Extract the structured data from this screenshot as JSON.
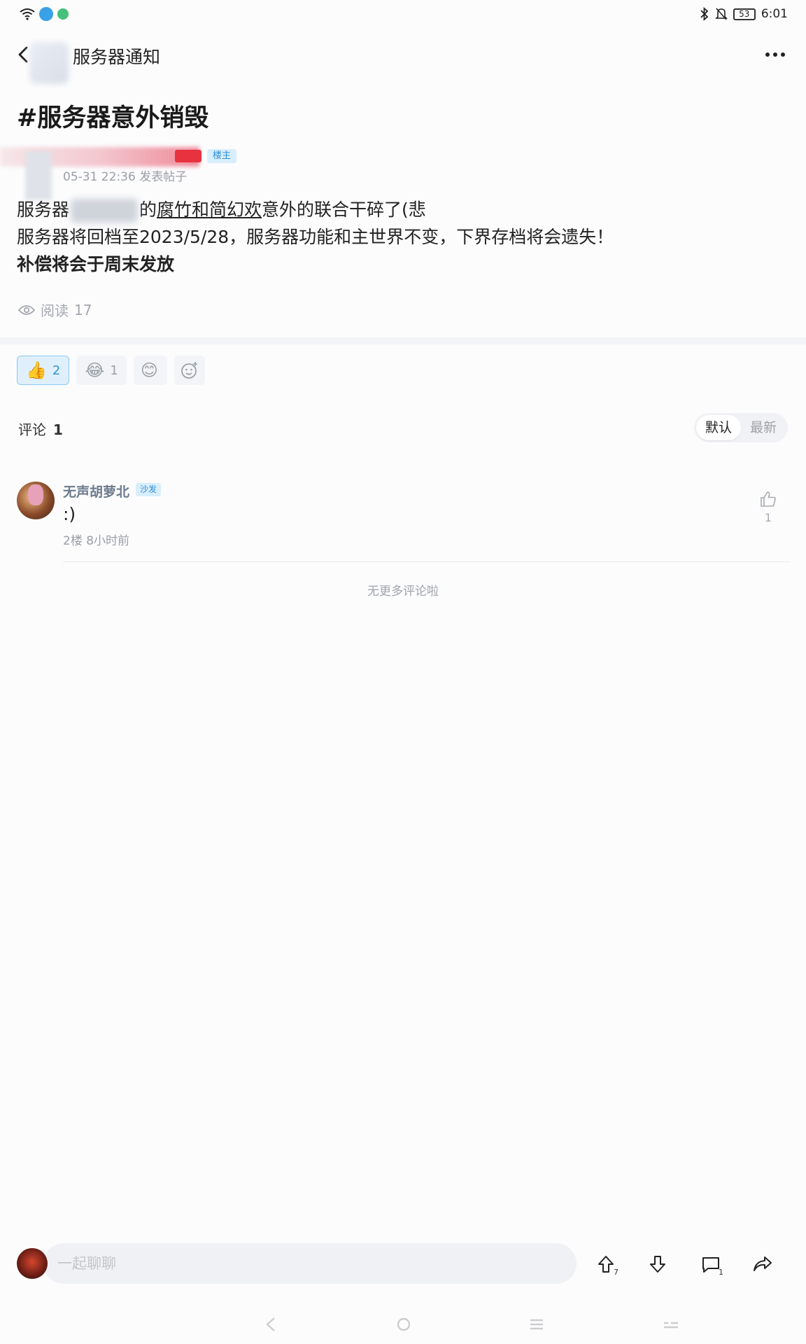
{
  "status_bar": {
    "battery": "53",
    "time": "6:01",
    "icons": [
      "wifi-icon",
      "bluetooth-icon",
      "bell-mute-icon",
      "battery-icon"
    ]
  },
  "header": {
    "title": "服务器通知",
    "back_icon": "chevron-left-icon",
    "more_icon": "more-dots-icon"
  },
  "post": {
    "title": "#服务器意外销毁",
    "author_badge": "楼主",
    "meta": "05-31 22:36 发表帖子",
    "body": {
      "line1_prefix": "服务器",
      "line1_mid": "的",
      "line1_link": "腐竹和简幻欢",
      "line1_suffix": "意外的联合干碎了(悲",
      "line2": "服务器将回档至2023/5/28，服务器功能和主世界不变，下界存档将会遗失！",
      "line3": "补偿将会于周末发放"
    },
    "reads_label": "阅读",
    "reads_count": "17"
  },
  "reactions": [
    {
      "icon": "thumbs-up-emoji",
      "count": "2",
      "active": true
    },
    {
      "icon": "laughing-crying-emoji",
      "count": "1",
      "active": false
    },
    {
      "icon": "blushing-emoji",
      "count": "",
      "active": false
    },
    {
      "icon": "add-emoji-icon",
      "count": "",
      "active": false
    }
  ],
  "comments": {
    "label": "评论",
    "count": "1",
    "sort_default": "默认",
    "sort_latest": "最新",
    "items": [
      {
        "name": "无声胡萝北",
        "badge": "沙发",
        "text": ":)",
        "meta": "2楼 8小时前",
        "likes": "1"
      }
    ],
    "no_more": "无更多评论啦"
  },
  "bottom_bar": {
    "input_placeholder": "一起聊聊",
    "upvote_count": "7",
    "comment_count": "1"
  },
  "colors": {
    "accent": "#2c8fd9",
    "reaction_active_bg": "#dff0fc",
    "text_primary": "#222222",
    "text_secondary": "#9a9ea6"
  }
}
